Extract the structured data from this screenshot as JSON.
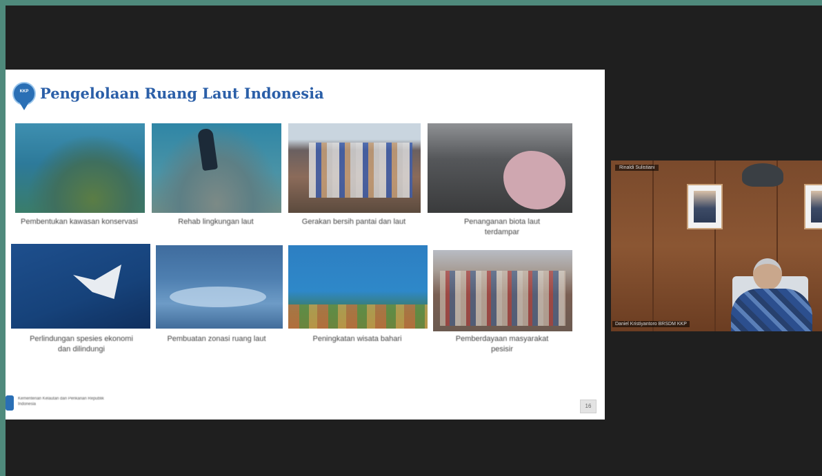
{
  "slide": {
    "title": "Pengelolaan Ruang Laut Indonesia",
    "logo_text": "KKP",
    "items": [
      {
        "caption": "Pembentukan kawasan konservasi"
      },
      {
        "caption": "Rehab lingkungan laut"
      },
      {
        "caption": "Gerakan bersih pantai dan laut"
      },
      {
        "caption": "Penanganan biota laut terdampar"
      },
      {
        "caption": "Perlindungan spesies ekonomi dan dilindungi"
      },
      {
        "caption": "Pembuatan zonasi ruang laut"
      },
      {
        "caption": "Peningkatan wisata bahari"
      },
      {
        "caption": "Pemberdayaan masyarakat pesisir"
      }
    ],
    "footer": "Kementerian Kelautan dan Perikanan Republik Indonesia",
    "page_number": "16"
  },
  "participant": {
    "top_label": "Rinaldi Sulistiani",
    "bottom_label": "Daniel Kristiyantoro BRSDM KKP"
  },
  "colors": {
    "background": "#4f8a7c",
    "stage": "#1f1f1f",
    "slide_title": "#2b5fa8"
  }
}
